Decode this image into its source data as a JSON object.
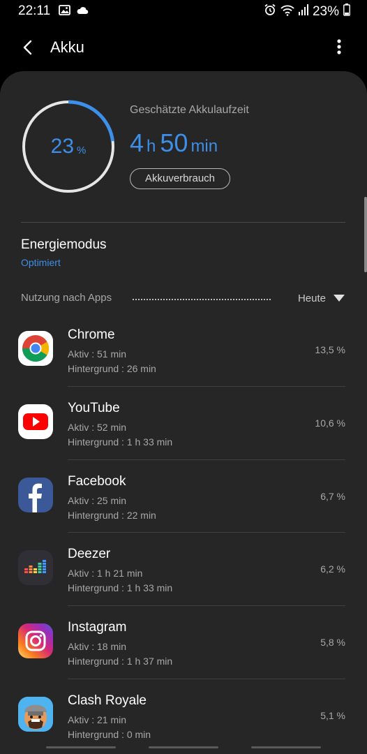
{
  "status_bar": {
    "time": "22:11",
    "battery_percent": "23%",
    "icons": [
      "image-icon",
      "cloud-icon",
      "alarm-icon",
      "wifi-icon",
      "signal-icon",
      "battery-icon"
    ]
  },
  "app_bar": {
    "title": "Akku",
    "icons": [
      "back-arrow-icon",
      "more-vert-icon"
    ]
  },
  "battery": {
    "level_value": "23",
    "level_unit": "%",
    "level_fraction": 0.23,
    "estimate_label": "Geschätzte Akkulaufzeit",
    "estimate_hours": "4",
    "estimate_hours_unit": "h",
    "estimate_minutes": "50",
    "estimate_minutes_unit": "min",
    "usage_button_label": "Akkuverbrauch"
  },
  "energy_mode": {
    "title": "Energiemodus",
    "value": "Optimiert"
  },
  "usage": {
    "label": "Nutzung nach Apps",
    "period": "Heute",
    "apps": [
      {
        "name": "Chrome",
        "icon": "chrome-icon",
        "active": "Aktiv : 51 min",
        "background": "Hintergrund : 26 min",
        "percent": "13,5 %"
      },
      {
        "name": "YouTube",
        "icon": "youtube-icon",
        "active": "Aktiv : 52 min",
        "background": "Hintergrund : 1 h 33 min",
        "percent": "10,6 %"
      },
      {
        "name": "Facebook",
        "icon": "facebook-icon",
        "active": "Aktiv : 25 min",
        "background": "Hintergrund : 22 min",
        "percent": "6,7 %"
      },
      {
        "name": "Deezer",
        "icon": "deezer-icon",
        "active": "Aktiv : 1 h 21 min",
        "background": "Hintergrund : 1 h 33 min",
        "percent": "6,2 %"
      },
      {
        "name": "Instagram",
        "icon": "instagram-icon",
        "active": "Aktiv : 18 min",
        "background": "Hintergrund : 1 h 37 min",
        "percent": "5,8 %"
      },
      {
        "name": "Clash Royale",
        "icon": "clash-royale-icon",
        "active": "Aktiv : 21 min",
        "background": "Hintergrund : 0 min",
        "percent": "5,1 %"
      }
    ]
  },
  "colors": {
    "accent": "#3d8fe8",
    "card": "#262626",
    "background": "#000000",
    "secondary_text": "#a8a8a8"
  }
}
